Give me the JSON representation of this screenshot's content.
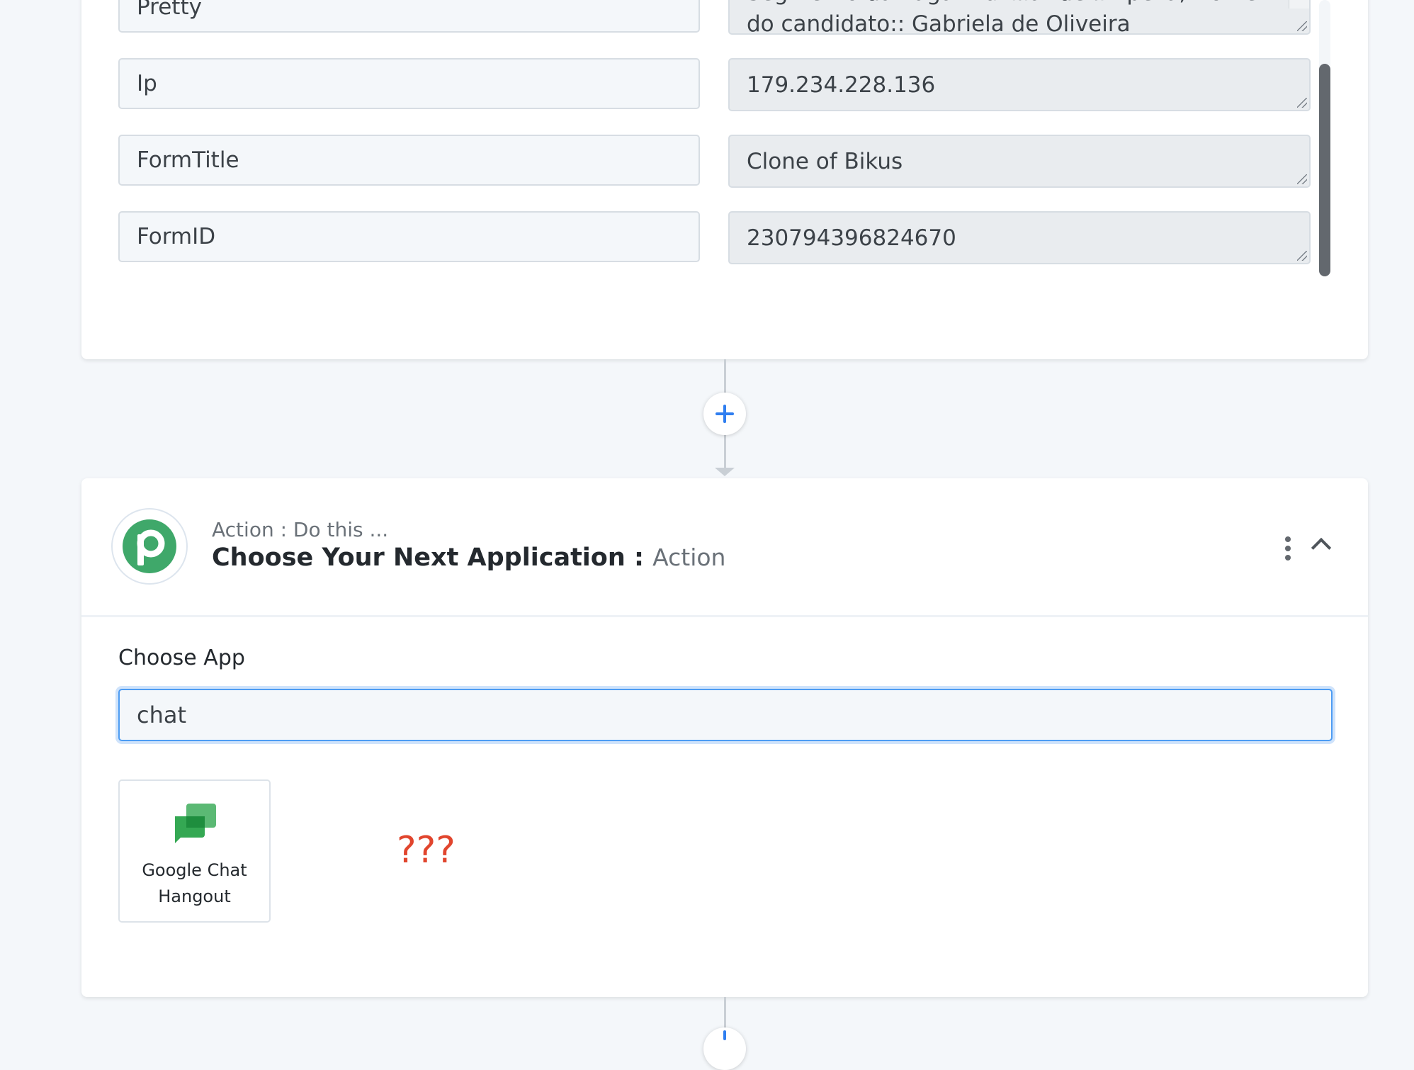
{
  "mapping_rows": [
    {
      "key": "Pretty",
      "value": "Segmento da vaga::Auxiliar de limpeza, Nome do candidato:: Gabriela de Oliveira"
    },
    {
      "key": "Ip",
      "value": "179.234.228.136"
    },
    {
      "key": "FormTitle",
      "value": "Clone of Bikus"
    },
    {
      "key": "FormID",
      "value": "230794396824670"
    }
  ],
  "action_step": {
    "subtitle": "Action : Do this ...",
    "title": "Choose Your Next Application :",
    "title_suffix": "Action",
    "logo_letter": "P",
    "choose_app_label": "Choose App",
    "search_value": "chat",
    "results": [
      {
        "name_line1": "Google Chat",
        "name_line2": "Hangout",
        "icon": "google-chat-icon"
      }
    ],
    "annotation": "???"
  },
  "colors": {
    "accent": "#2f7ef0",
    "logo_green": "#3fa86a",
    "annotation_red": "#e1452d"
  }
}
